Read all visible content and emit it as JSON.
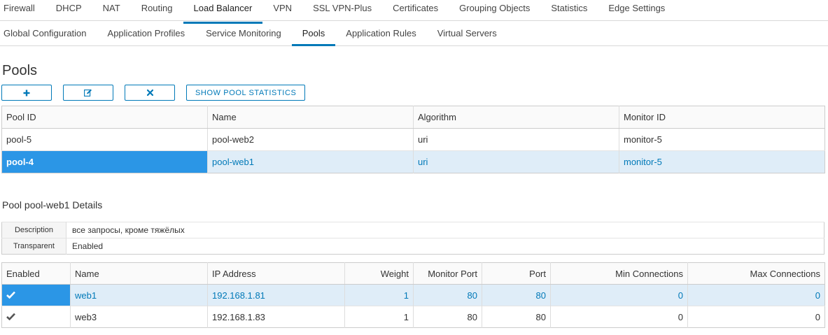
{
  "top_tabs": [
    {
      "label": "Firewall",
      "active": false
    },
    {
      "label": "DHCP",
      "active": false
    },
    {
      "label": "NAT",
      "active": false
    },
    {
      "label": "Routing",
      "active": false
    },
    {
      "label": "Load Balancer",
      "active": true
    },
    {
      "label": "VPN",
      "active": false
    },
    {
      "label": "SSL VPN-Plus",
      "active": false
    },
    {
      "label": "Certificates",
      "active": false
    },
    {
      "label": "Grouping Objects",
      "active": false
    },
    {
      "label": "Statistics",
      "active": false
    },
    {
      "label": "Edge Settings",
      "active": false
    }
  ],
  "sub_tabs": [
    {
      "label": "Global Configuration",
      "active": false
    },
    {
      "label": "Application Profiles",
      "active": false
    },
    {
      "label": "Service Monitoring",
      "active": false
    },
    {
      "label": "Pools",
      "active": true
    },
    {
      "label": "Application Rules",
      "active": false
    },
    {
      "label": "Virtual Servers",
      "active": false
    }
  ],
  "page_title": "Pools",
  "toolbar": {
    "add_icon": "plus-icon",
    "edit_icon": "edit-icon",
    "delete_icon": "close-icon",
    "stats_label": "SHOW POOL STATISTICS"
  },
  "pools_table": {
    "columns": [
      "Pool ID",
      "Name",
      "Algorithm",
      "Monitor ID"
    ],
    "rows": [
      {
        "id": "pool-5",
        "name": "pool-web2",
        "algorithm": "uri",
        "monitor": "monitor-5",
        "selected": false
      },
      {
        "id": "pool-4",
        "name": "pool-web1",
        "algorithm": "uri",
        "monitor": "monitor-5",
        "selected": true
      }
    ]
  },
  "details": {
    "title": "Pool pool-web1 Details",
    "description_label": "Description",
    "description_value": "все запросы, кроме тяжёлых",
    "transparent_label": "Transparent",
    "transparent_value": "Enabled"
  },
  "members_table": {
    "columns": [
      "Enabled",
      "Name",
      "IP Address",
      "Weight",
      "Monitor Port",
      "Port",
      "Min Connections",
      "Max Connections"
    ],
    "rows": [
      {
        "enabled_icon": "check-icon",
        "name": "web1",
        "ip": "192.168.1.81",
        "weight": "1",
        "monitor_port": "80",
        "port": "80",
        "min": "0",
        "max": "0",
        "selected": true
      },
      {
        "enabled_icon": "check-icon",
        "name": "web3",
        "ip": "192.168.1.83",
        "weight": "1",
        "monitor_port": "80",
        "port": "80",
        "min": "0",
        "max": "0",
        "selected": false
      }
    ]
  },
  "colors": {
    "accent": "#0079b8",
    "selected_key_bg": "#2b96e6",
    "selected_row_bg": "#dfedf8"
  }
}
